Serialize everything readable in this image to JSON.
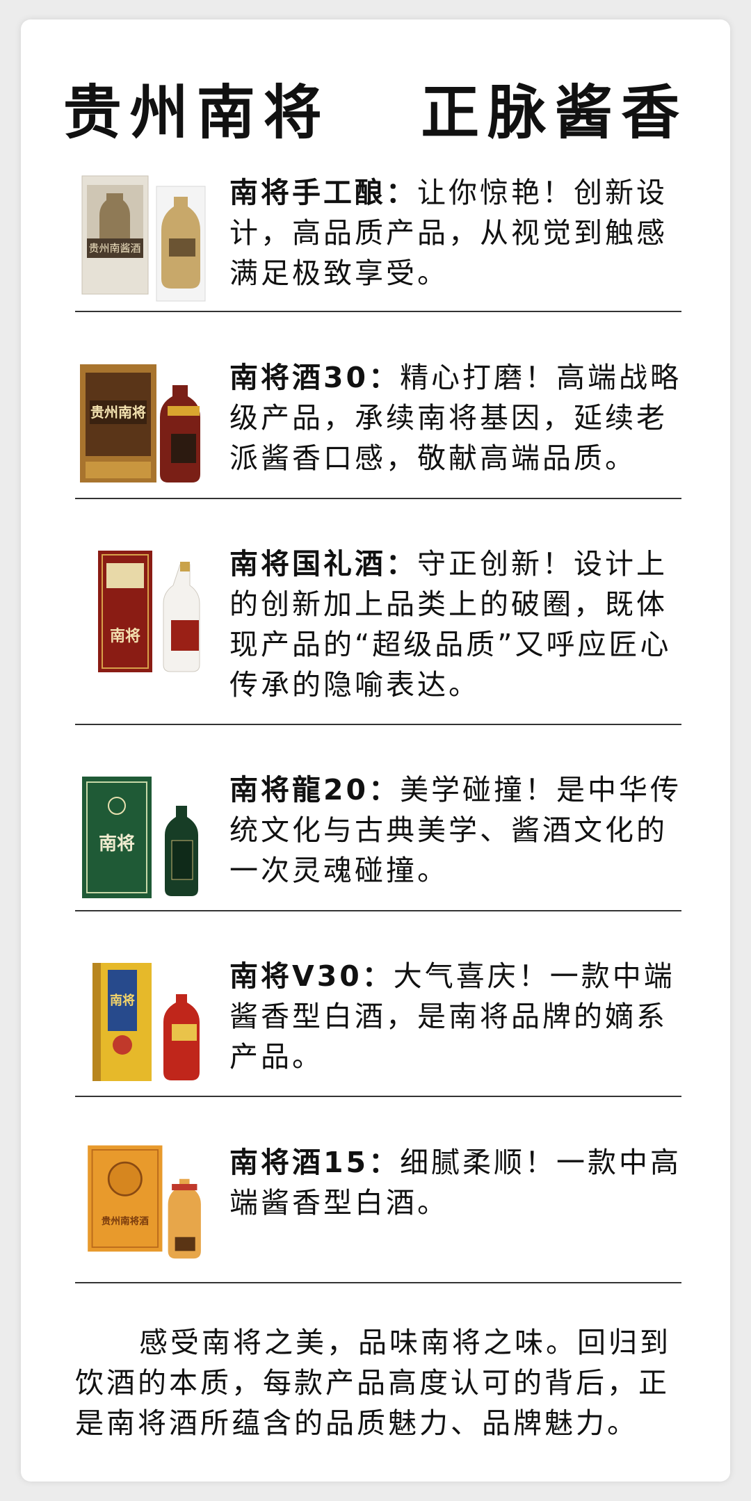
{
  "title": "贵州南将  正脉酱香",
  "products": [
    {
      "name": "南将手工酿",
      "sep": "：",
      "text": "让你惊艳！创新设计，高品质产品，从视觉到触感满足极致享受。",
      "image": "bottle-and-box-icon"
    },
    {
      "name": "南将酒30",
      "sep": "：",
      "text": "精心打磨！高端战略级产品，承续南将基因，延续老派酱香口感，敬献高端品质。",
      "image": "bottle-and-box-icon"
    },
    {
      "name": "南将国礼酒",
      "sep": "：",
      "text": "守正创新！设计上的创新加上品类上的破圈，既体现产品的“超级品质”又呼应匠心传承的隐喻表达。",
      "image": "bottle-and-box-icon"
    },
    {
      "name": "南将龍20",
      "sep": "：",
      "text": "美学碰撞！是中华传统文化与古典美学、酱酒文化的一次灵魂碰撞。",
      "image": "bottle-and-box-icon"
    },
    {
      "name": "南将V30",
      "sep": "：",
      "text": "大气喜庆！一款中端酱香型白酒，是南将品牌的嫡系产品。",
      "image": "bottle-and-box-icon"
    },
    {
      "name": "南将酒15",
      "sep": "：",
      "text": "细腻柔顺！一款中高端酱香型白酒。",
      "image": "bottle-and-box-icon"
    }
  ],
  "box_labels": [
    "贵州南酱酒",
    "贵州南将",
    "南将",
    "南将",
    "南将",
    "贵州南将酒"
  ],
  "summary": "感受南将之美，品味南将之味。回归到饮酒的本质，每款产品高度认可的背后，正是南将酒所蕴含的品质魅力、品牌魅力。"
}
